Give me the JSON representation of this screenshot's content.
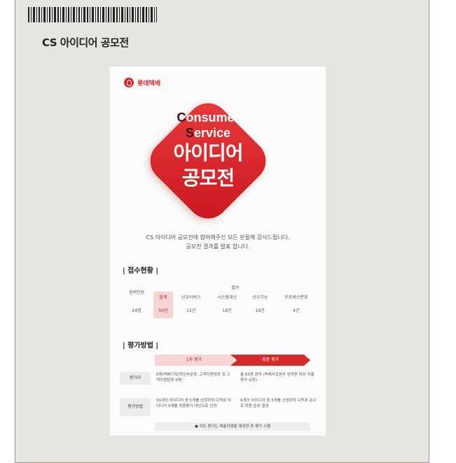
{
  "page": {
    "title": "CS 아이디어 공모전"
  },
  "poster": {
    "brand": "롯데택배",
    "hero_line1_cap": "C",
    "hero_line1_rest": "onsumer",
    "hero_line2_cap": "S",
    "hero_line2_rest": "ervice",
    "hero_line3": "아이디어",
    "hero_line4": "공모전",
    "intro_line1": "CS 아이디어 공모전에 참여해주신 모든 분들께 감사드립니다.",
    "intro_line2": "공모전 결과를 발표 합니다.",
    "section1_title": "| 접수현황 |",
    "table": {
      "participants_header": "참여인원",
      "received_header": "접수",
      "subheaders": [
        "합계",
        "신규서비스",
        "시스템개선",
        "신규기능",
        "프로세스변경"
      ],
      "participants_value": "24명",
      "values": [
        "50건",
        "12건",
        "18건",
        "16건",
        "4건"
      ]
    },
    "section2_title": "| 평가방법 |",
    "eval": {
      "step1": "1차 평가",
      "step2": "최종 평가",
      "row1_label": "평가자",
      "row1_col1": "6명(택배기획/혁신부문장, 고객지원팀장 및 고객지원팀원 4명)",
      "row1_col2": "총 83명 참여 (택배사업본부 임직원 대상 자율 평가 요청)",
      "row2_label": "평가방법",
      "row2_col1": "50개의 아이디어 중 5개를 선정하여 다득표 아이디어 9개를 최종평가 대상으로 선정",
      "row2_col2": "9개의 아이디어 중 3개를 선정하여 다득표 순으로 최종 순위 결정",
      "note": "● 모든 평가는 제출자명을 제외한 후 평가 시행"
    }
  },
  "colors": {
    "accent": "#d8282d",
    "panel": "#e7e5df"
  }
}
